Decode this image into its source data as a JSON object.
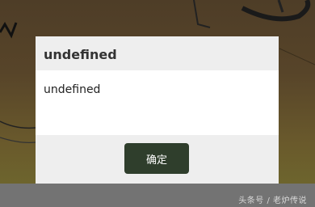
{
  "dialog": {
    "title": "undefined",
    "message": "undefined",
    "confirm_label": "确定"
  },
  "watermark": "头条号 / 老炉传说",
  "colors": {
    "backdrop": "#574429",
    "dialog_header": "#eeeeee",
    "button": "#2f3e2c",
    "bottom_bar": "#737373"
  }
}
